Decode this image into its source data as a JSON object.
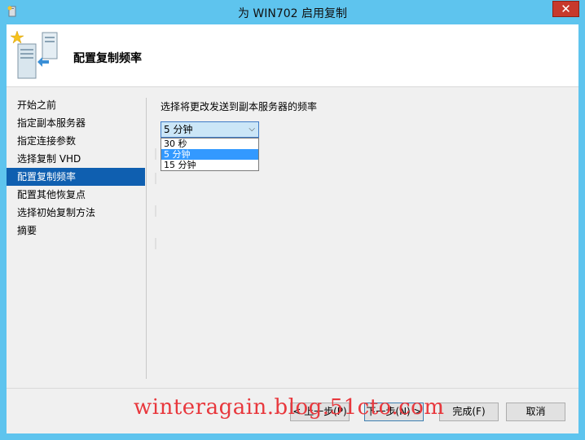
{
  "window": {
    "title": "为 WIN702 启用复制",
    "close_glyph": "✕"
  },
  "header": {
    "title": "配置复制频率"
  },
  "nav": {
    "items": [
      {
        "label": "开始之前"
      },
      {
        "label": "指定副本服务器"
      },
      {
        "label": "指定连接参数"
      },
      {
        "label": "选择复制 VHD"
      },
      {
        "label": "配置复制频率",
        "active": true
      },
      {
        "label": "配置其他恢复点"
      },
      {
        "label": "选择初始复制方法"
      },
      {
        "label": "摘要"
      }
    ]
  },
  "main": {
    "prompt": "选择将更改发送到副本服务器的频率",
    "frequency": {
      "selected": "5 分钟",
      "options": [
        "30 秒",
        "5 分钟",
        "15 分钟"
      ],
      "highlighted_index": 1
    }
  },
  "buttons": {
    "previous": "< 上一步(P)",
    "next": "下一步(N) >",
    "finish": "完成(F)",
    "cancel": "取消"
  },
  "watermark": "winteragain.blog.51cto.com",
  "colors": {
    "title_bar": "#5ec4ee",
    "nav_active": "#0f5fb0",
    "option_highlight": "#3399ff",
    "close_button": "#c7392c"
  }
}
